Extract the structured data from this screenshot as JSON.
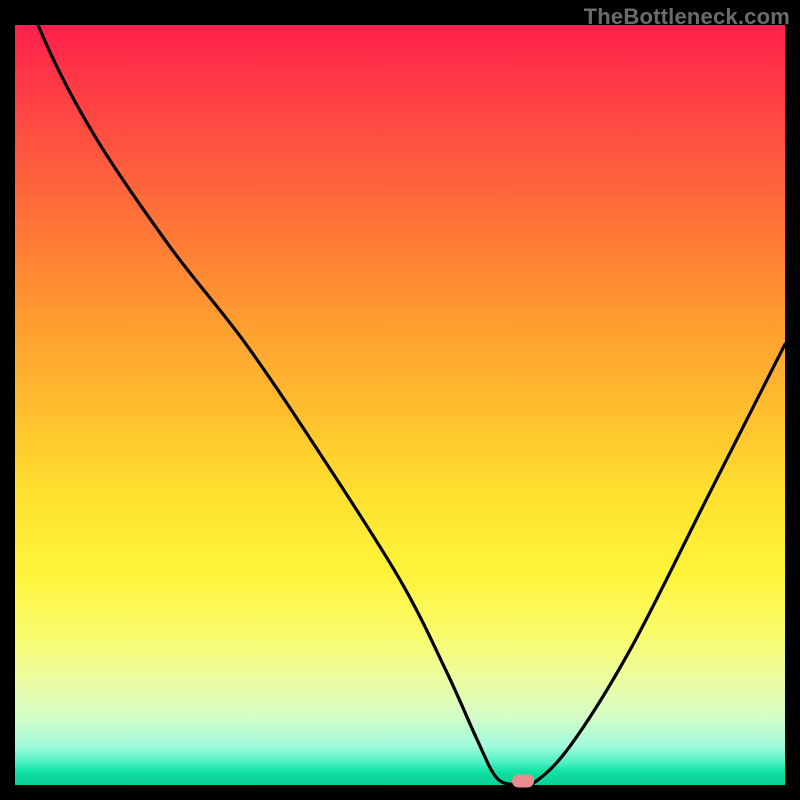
{
  "watermark": "TheBottleneck.com",
  "colors": {
    "background": "#000000",
    "top": "#ff1f4b",
    "mid": "#ffe12f",
    "bottom": "#0cd095",
    "curve": "#000000",
    "marker": "#e98b8f",
    "watermark_text": "#6b6b6b"
  },
  "chart_data": {
    "type": "line",
    "title": "",
    "xlabel": "",
    "ylabel": "",
    "xlim": [
      0,
      100
    ],
    "ylim": [
      0,
      100
    ],
    "grid": false,
    "series": [
      {
        "name": "bottleneck-curve",
        "x": [
          0,
          3,
          10,
          20,
          30,
          40,
          50,
          56,
          60,
          62.5,
          65,
          67,
          72,
          80,
          90,
          100
        ],
        "values": [
          111,
          100,
          86,
          71,
          58,
          43,
          27,
          15,
          6,
          1,
          0,
          0,
          5,
          18,
          38,
          58
        ]
      }
    ],
    "marker": {
      "x": 66,
      "y": 0
    },
    "legend": false,
    "annotations": []
  }
}
